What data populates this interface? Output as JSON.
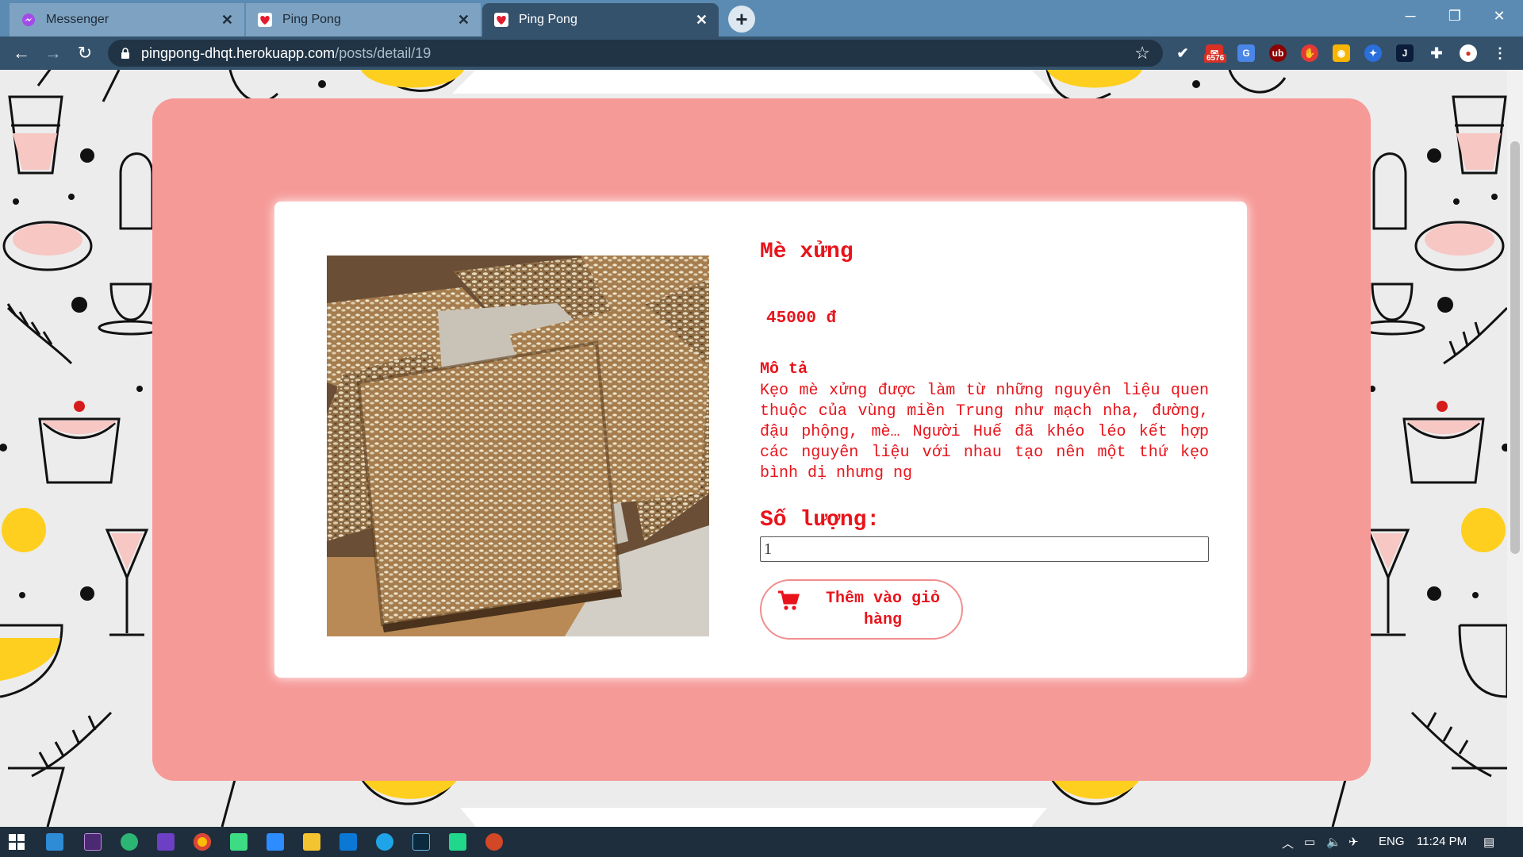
{
  "browser": {
    "tabs": [
      {
        "title": "Messenger",
        "active": false
      },
      {
        "title": "Ping Pong",
        "active": false
      },
      {
        "title": "Ping Pong",
        "active": true
      }
    ],
    "url_host": "pingpong-dhqt.herokuapp.com",
    "url_path": "/posts/detail/19",
    "ext_badge": "6576"
  },
  "product": {
    "name": "Mè xửng",
    "price": "45000 đ",
    "description_heading": "Mô tả",
    "description": "Kẹo mè xửng được làm từ những nguyên liệu quen thuộc của vùng miền Trung như mạch nha, đường, đậu phộng, mè… Người Huế đã khéo léo kết hợp các nguyên liệu với nhau tạo nên một thứ kẹo bình dị nhưng ng",
    "quantity_label": "Số lượng:",
    "quantity_value": "1",
    "add_to_cart_label": "Thêm vào giỏ hàng"
  },
  "taskbar": {
    "language": "ENG",
    "time": "11:24 PM"
  },
  "colors": {
    "accent": "#e8141b",
    "card": "#f69a98",
    "chrome": "#35526c"
  }
}
